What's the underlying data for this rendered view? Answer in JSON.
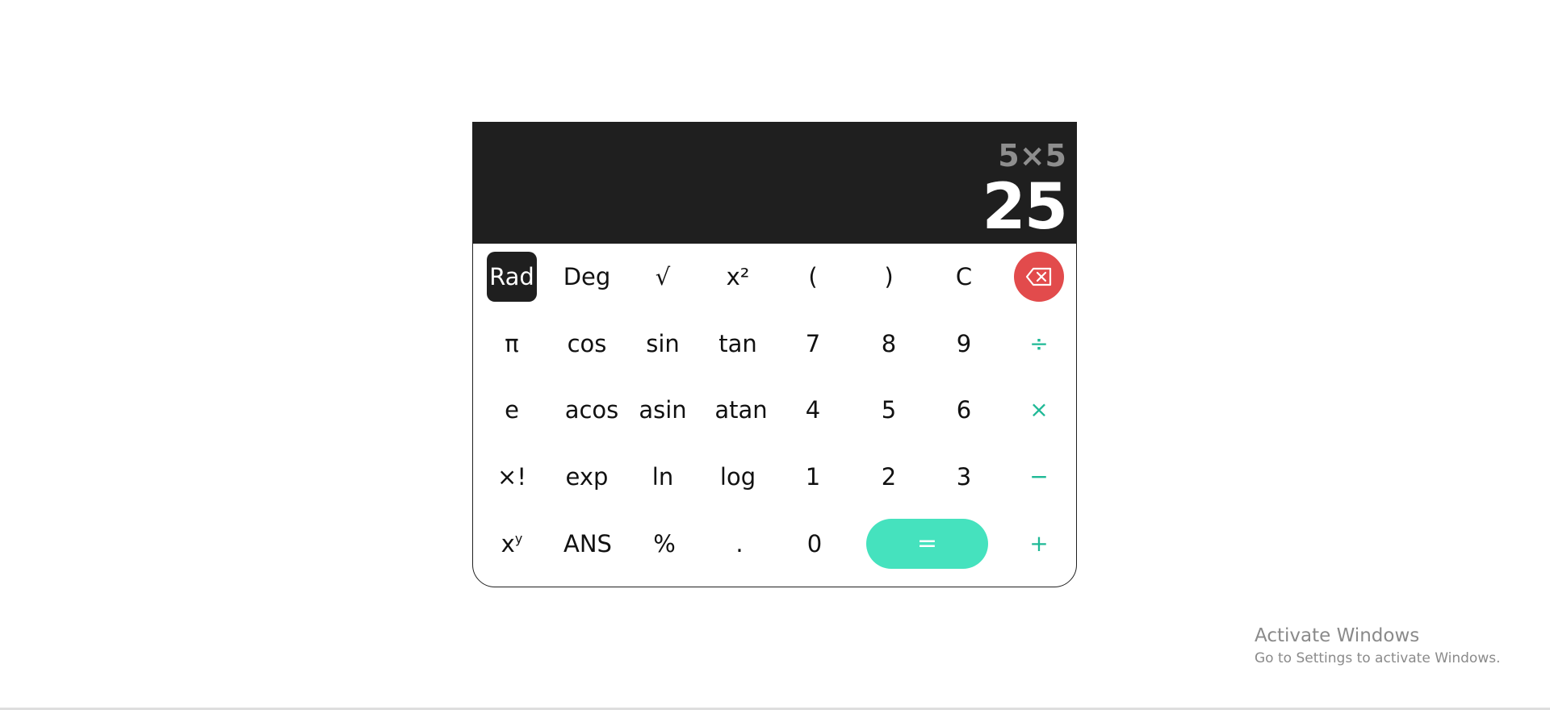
{
  "display": {
    "expression": "5×5",
    "result": "25"
  },
  "keys": {
    "rad": "Rad",
    "deg": "Deg",
    "sqrt": "√",
    "square": "x²",
    "open_paren": "(",
    "close_paren": ")",
    "clear": "C",
    "pi": "π",
    "cos": "cos",
    "sin": "sin",
    "tan": "tan",
    "seven": "7",
    "eight": "8",
    "nine": "9",
    "divide": "÷",
    "e": "e",
    "acos": "acos",
    "asin": "asin",
    "atan": "atan",
    "four": "4",
    "five": "5",
    "six": "6",
    "multiply": "×",
    "factorial": "×!",
    "exp": "exp",
    "ln": "ln",
    "log": "log",
    "one": "1",
    "two": "2",
    "three": "3",
    "minus": "−",
    "power_base": "x",
    "power_exp": "y",
    "ans": "ANS",
    "percent": "%",
    "decimal": ".",
    "zero": "0",
    "equals": "=",
    "plus": "+"
  },
  "icons": {
    "backspace": "backspace-icon"
  },
  "colors": {
    "display_bg": "#1f1f1f",
    "expression": "#8e8e8e",
    "result": "#ffffff",
    "operator": "#1fb996",
    "equals_bg": "#45e2be",
    "backspace_bg": "#e24b4c",
    "rad_bg": "#1f1f1f"
  },
  "watermark": {
    "title": "Activate Windows",
    "subtitle": "Go to Settings to activate Windows."
  }
}
